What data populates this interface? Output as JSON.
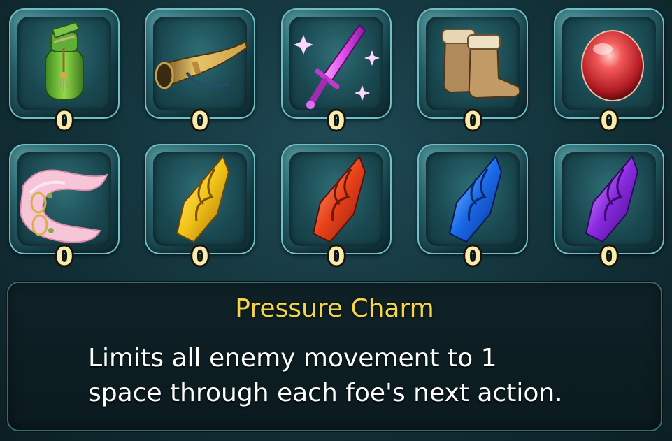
{
  "items": [
    {
      "name": "healing-tonic",
      "icon": "green-bottle-icon",
      "count": "0"
    },
    {
      "name": "horn",
      "icon": "horn-icon",
      "count": "0"
    },
    {
      "name": "dagger",
      "icon": "glowing-dagger-icon",
      "count": "0"
    },
    {
      "name": "boots",
      "icon": "boots-icon",
      "count": "0"
    },
    {
      "name": "red-orb",
      "icon": "red-orb-icon",
      "count": "0"
    },
    {
      "name": "pressure-charm",
      "icon": "pink-scarf-icon",
      "count": "0"
    },
    {
      "name": "yellow-crystal",
      "icon": "yellow-crystal-icon",
      "count": "0"
    },
    {
      "name": "red-crystal",
      "icon": "red-crystal-icon",
      "count": "0"
    },
    {
      "name": "blue-crystal",
      "icon": "blue-crystal-icon",
      "count": "0"
    },
    {
      "name": "purple-crystal",
      "icon": "purple-crystal-icon",
      "count": "0"
    }
  ],
  "info": {
    "title": "Pressure Charm",
    "description_line1": "Limits all enemy movement to 1",
    "description_line2": "space through each foe's next action."
  },
  "colors": {
    "title": "#f4d44a",
    "count": "#f6ecb0",
    "description": "#ffffff"
  }
}
